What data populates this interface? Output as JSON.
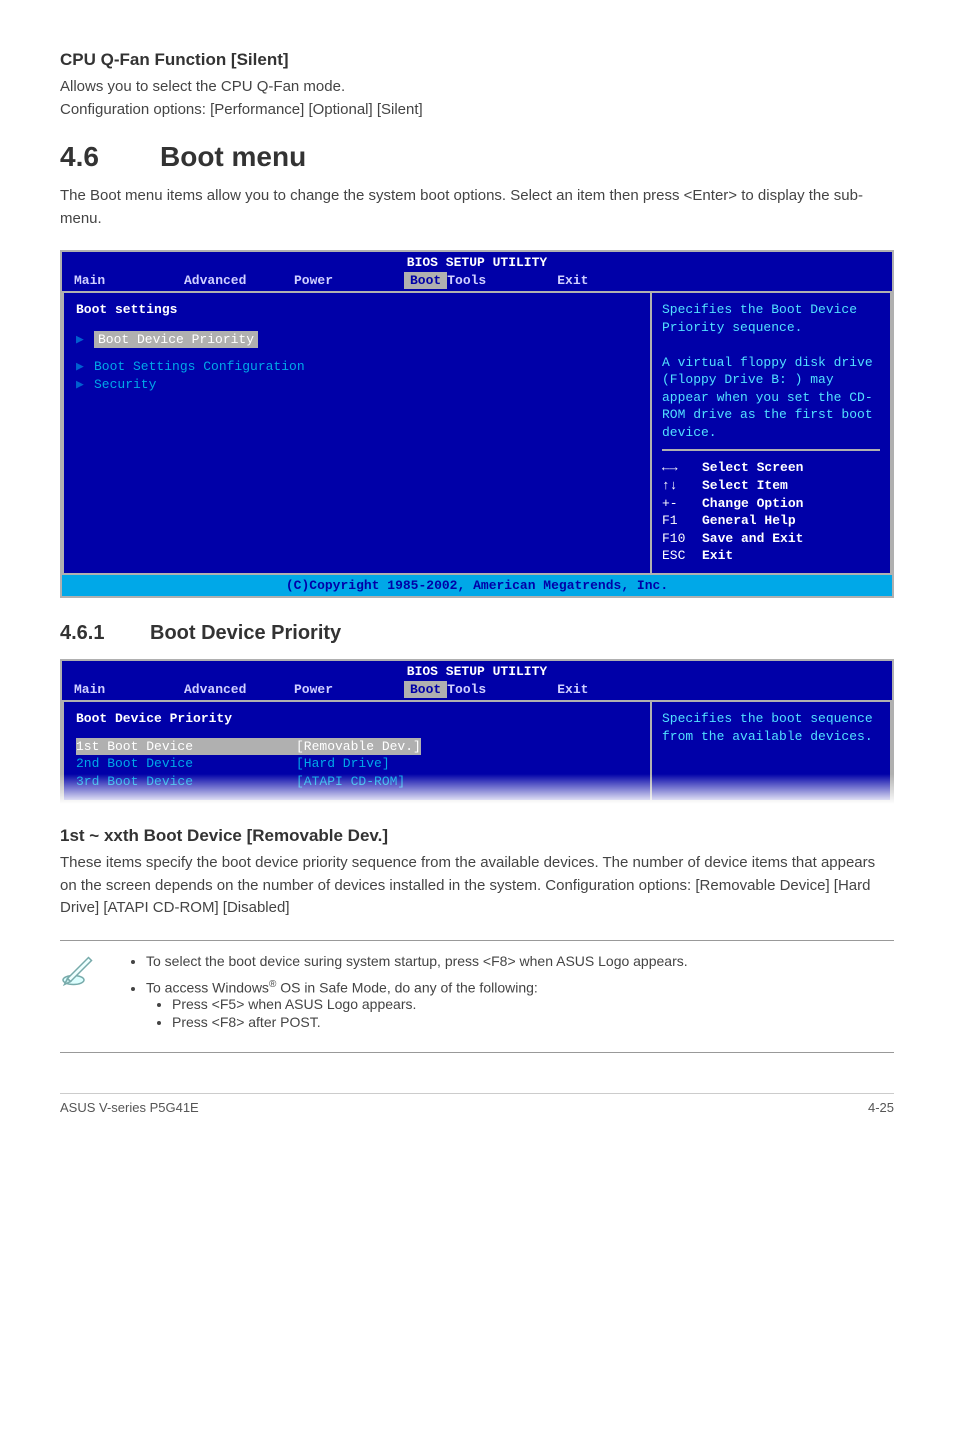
{
  "section_cpu": {
    "title": "CPU Q-Fan Function [Silent]",
    "line1": "Allows you to select the CPU Q-Fan mode.",
    "line2": "Configuration options: [Performance] [Optional] [Silent]"
  },
  "section_boot": {
    "num": "4.6",
    "title": "Boot menu",
    "intro": "The Boot menu items allow you to change the system boot options. Select an item then press <Enter> to display the sub-menu."
  },
  "bios1": {
    "utility_title": "BIOS SETUP UTILITY",
    "tabs": [
      "Main",
      "Advanced",
      "Power",
      "Boot",
      "Tools",
      "Exit"
    ],
    "left_title": "Boot settings",
    "items": [
      "Boot Device Priority",
      "Boot Settings Configuration",
      "Security"
    ],
    "help": "Specifies the Boot Device Priority sequence.\n\nA virtual floppy disk drive (Floppy Drive B: ) may appear when you set the CD-ROM drive as the first boot device.",
    "keys": [
      {
        "k": "←→",
        "d": "Select Screen"
      },
      {
        "k": "↑↓",
        "d": "Select Item"
      },
      {
        "k": "+-",
        "d": "Change Option"
      },
      {
        "k": "F1",
        "d": "General Help"
      },
      {
        "k": "F10",
        "d": "Save and Exit"
      },
      {
        "k": "ESC",
        "d": "Exit"
      }
    ],
    "footer": "(C)Copyright 1985-2002, American Megatrends, Inc."
  },
  "sub461": {
    "num": "4.6.1",
    "title": "Boot Device Priority"
  },
  "bios2": {
    "utility_title": "BIOS SETUP UTILITY",
    "tabs": [
      "Main",
      "Advanced",
      "Power",
      "Boot",
      "Tools",
      "Exit"
    ],
    "left_title": "Boot Device Priority",
    "rows": [
      {
        "label": "1st Boot Device",
        "value": "[Removable Dev.]",
        "sel": true
      },
      {
        "label": "2nd Boot Device",
        "value": "[Hard Drive]",
        "sel": false
      },
      {
        "label": "3rd Boot Device",
        "value": "[ATAPI CD-ROM]",
        "sel": false
      }
    ],
    "help": "Specifies the boot sequence from the available devices."
  },
  "section_1st": {
    "title": "1st ~ xxth Boot Device [Removable Dev.]",
    "body": "These items specify the boot device priority sequence from the available devices. The number of device items that appears on the screen depends on the number of devices installed in the system. Configuration options: [Removable Device] [Hard Drive] [ATAPI CD-ROM] [Disabled]"
  },
  "notes": {
    "n1": "To select the boot device suring system startup, press <F8> when ASUS Logo appears.",
    "n2_lead": "To access Windows",
    "n2_tail": " OS in Safe Mode, do any of the following:",
    "n2a": "Press <F5> when ASUS Logo appears.",
    "n2b": "Press <F8> after POST."
  },
  "footer": {
    "left": "ASUS V-series P5G41E",
    "right": "4-25"
  }
}
